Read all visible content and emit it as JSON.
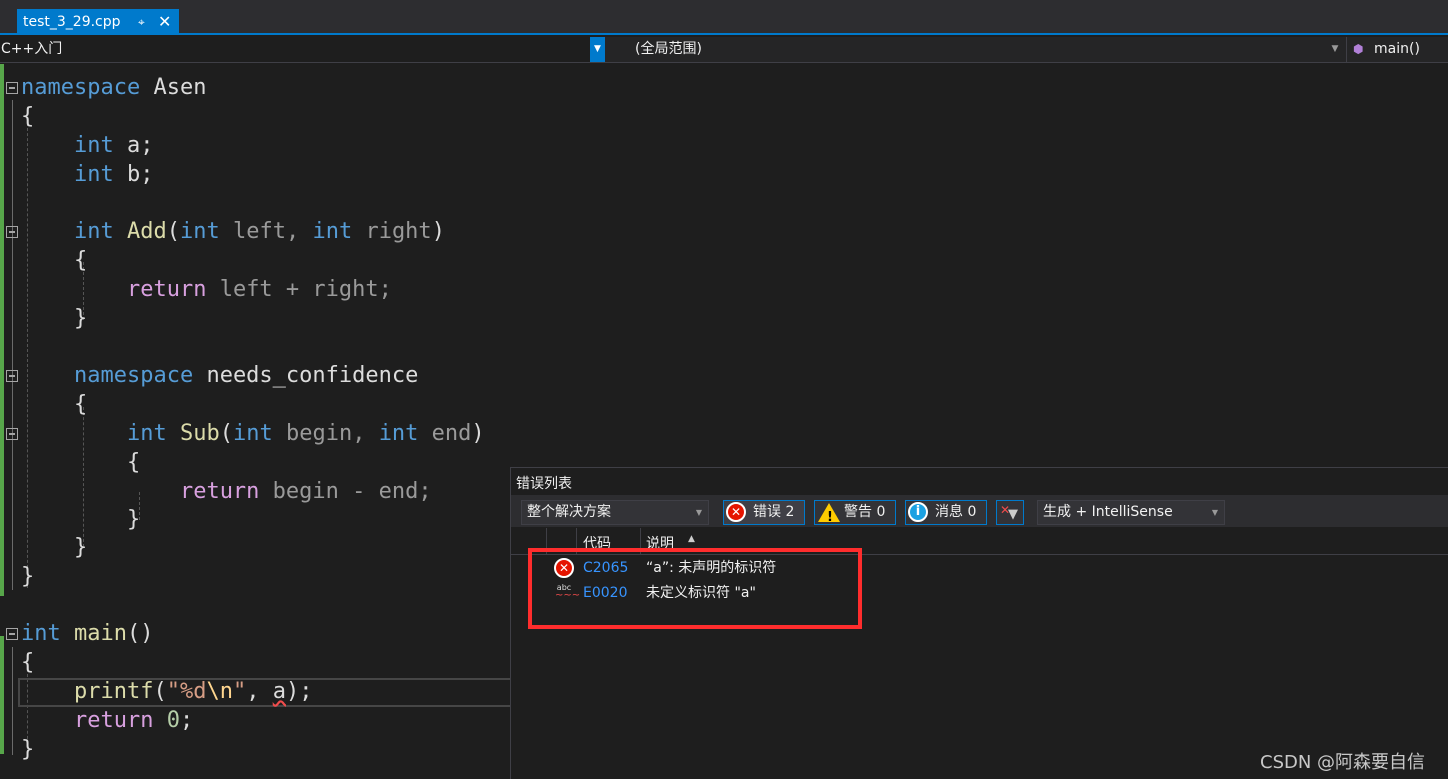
{
  "tab": {
    "title": "test_3_29.cpp",
    "pin_icon": "pin-icon",
    "close_icon": "close-icon"
  },
  "navbar": {
    "project": "C++入门",
    "scope": "(全局范围)",
    "member": "main()",
    "member_icon": "method-icon"
  },
  "code": {
    "l1_kw": "namespace",
    "l1_name": " Asen",
    "brace_open": "{",
    "brace_close": "}",
    "int": "int",
    "a_decl": " a;",
    "b_decl": " b;",
    "add_fn": "Add",
    "paren_open": "(",
    "left_param": " left, ",
    "right_param": " right",
    "paren_close": ")",
    "return": "return",
    "add_body": " left + right;",
    "namespace": "namespace",
    "ns2_name": " needs_confidence",
    "sub_fn": "Sub",
    "begin_param": " begin, ",
    "end_param": " end",
    "sub_body": " begin - end;",
    "main_fn": "main",
    "main_parens": "()",
    "printf": "printf",
    "fmt_open": "\"%d",
    "fmt_esc": "\\n",
    "fmt_close": "\"",
    "comma": ", ",
    "arg_a": "a",
    "end_call": ");",
    "zero": "0",
    "semicolon": ";",
    "space": " "
  },
  "error_list": {
    "title": "错误列表",
    "scope_dropdown": "整个解决方案",
    "errors_label": "错误 2",
    "warnings_label": "警告 0",
    "messages_label": "消息 0",
    "build_dropdown": "生成 + IntelliSense",
    "header_code": "代码",
    "header_desc": "说明",
    "rows": [
      {
        "icon": "error-icon",
        "code": "C2065",
        "desc": "“a”: 未声明的标识符"
      },
      {
        "icon": "intellisense-error-icon",
        "code": "E0020",
        "desc": "未定义标识符 \"a\""
      }
    ],
    "colors": {
      "accent": "#007acc",
      "error": "#e51400",
      "highlight": "#ff2d2d",
      "link": "#3794ff"
    }
  },
  "watermark": "CSDN @阿森要自信"
}
